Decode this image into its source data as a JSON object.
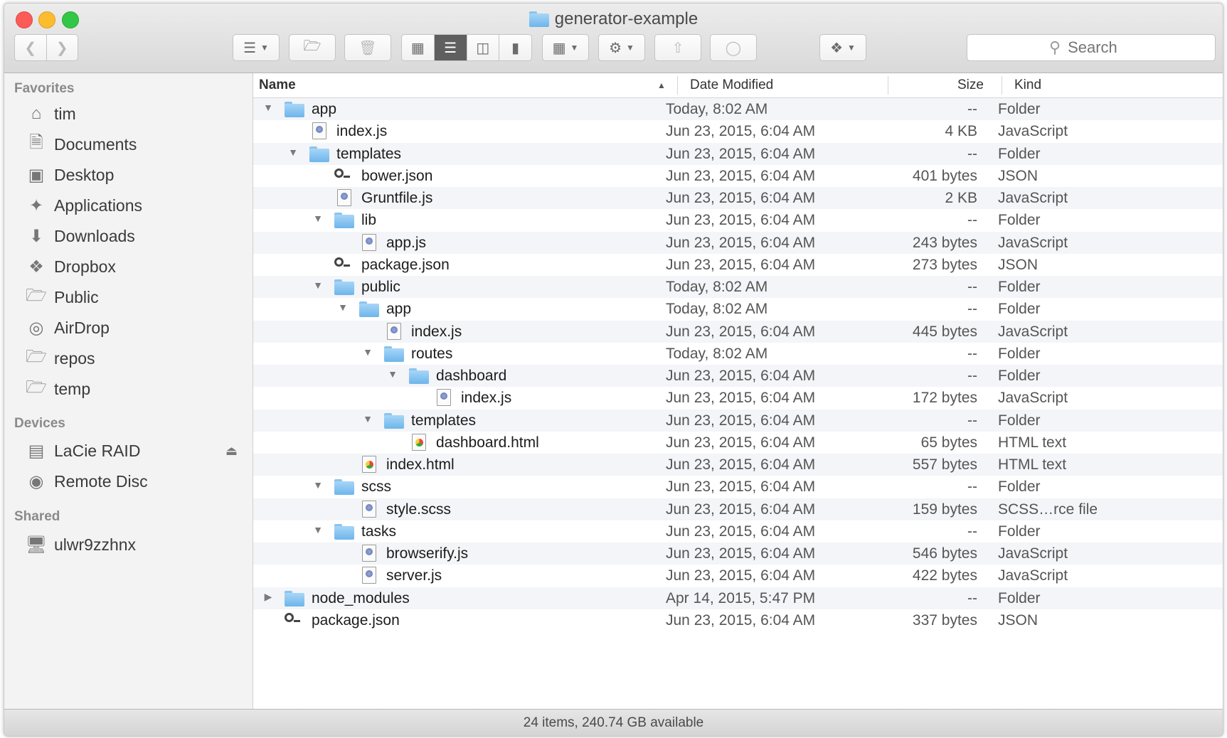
{
  "window": {
    "title": "generator-example",
    "status": "24 items, 240.74 GB available"
  },
  "toolbar": {
    "search_placeholder": "Search"
  },
  "sidebar": {
    "sections": [
      {
        "heading": "Favorites",
        "items": [
          {
            "label": "tim",
            "icon": "home-icon"
          },
          {
            "label": "Documents",
            "icon": "documents-icon"
          },
          {
            "label": "Desktop",
            "icon": "desktop-icon"
          },
          {
            "label": "Applications",
            "icon": "applications-icon"
          },
          {
            "label": "Downloads",
            "icon": "downloads-icon"
          },
          {
            "label": "Dropbox",
            "icon": "dropbox-icon"
          },
          {
            "label": "Public",
            "icon": "folder-icon"
          },
          {
            "label": "AirDrop",
            "icon": "airdrop-icon"
          },
          {
            "label": "repos",
            "icon": "folder-icon"
          },
          {
            "label": "temp",
            "icon": "folder-icon"
          }
        ]
      },
      {
        "heading": "Devices",
        "items": [
          {
            "label": "LaCie RAID",
            "icon": "drive-icon"
          },
          {
            "label": "Remote Disc",
            "icon": "disc-icon"
          }
        ]
      },
      {
        "heading": "Shared",
        "items": [
          {
            "label": "ulwr9zzhnx",
            "icon": "computer-icon"
          }
        ]
      }
    ]
  },
  "columns": {
    "name": "Name",
    "date": "Date Modified",
    "size": "Size",
    "kind": "Kind"
  },
  "files": [
    {
      "name": "app",
      "date": "Today, 8:02 AM",
      "size": "--",
      "kind": "Folder",
      "type": "folder",
      "depth": 0,
      "expanded": true
    },
    {
      "name": "index.js",
      "date": "Jun 23, 2015, 6:04 AM",
      "size": "4 KB",
      "kind": "JavaScript",
      "type": "js",
      "depth": 1
    },
    {
      "name": "templates",
      "date": "Jun 23, 2015, 6:04 AM",
      "size": "--",
      "kind": "Folder",
      "type": "folder",
      "depth": 1,
      "expanded": true
    },
    {
      "name": "bower.json",
      "date": "Jun 23, 2015, 6:04 AM",
      "size": "401 bytes",
      "kind": "JSON",
      "type": "json",
      "depth": 2
    },
    {
      "name": "Gruntfile.js",
      "date": "Jun 23, 2015, 6:04 AM",
      "size": "2 KB",
      "kind": "JavaScript",
      "type": "js",
      "depth": 2
    },
    {
      "name": "lib",
      "date": "Jun 23, 2015, 6:04 AM",
      "size": "--",
      "kind": "Folder",
      "type": "folder",
      "depth": 2,
      "expanded": true
    },
    {
      "name": "app.js",
      "date": "Jun 23, 2015, 6:04 AM",
      "size": "243 bytes",
      "kind": "JavaScript",
      "type": "js",
      "depth": 3
    },
    {
      "name": "package.json",
      "date": "Jun 23, 2015, 6:04 AM",
      "size": "273 bytes",
      "kind": "JSON",
      "type": "json",
      "depth": 2
    },
    {
      "name": "public",
      "date": "Today, 8:02 AM",
      "size": "--",
      "kind": "Folder",
      "type": "folder",
      "depth": 2,
      "expanded": true
    },
    {
      "name": "app",
      "date": "Today, 8:02 AM",
      "size": "--",
      "kind": "Folder",
      "type": "folder",
      "depth": 3,
      "expanded": true
    },
    {
      "name": "index.js",
      "date": "Jun 23, 2015, 6:04 AM",
      "size": "445 bytes",
      "kind": "JavaScript",
      "type": "js",
      "depth": 4
    },
    {
      "name": "routes",
      "date": "Today, 8:02 AM",
      "size": "--",
      "kind": "Folder",
      "type": "folder",
      "depth": 4,
      "expanded": true
    },
    {
      "name": "dashboard",
      "date": "Jun 23, 2015, 6:04 AM",
      "size": "--",
      "kind": "Folder",
      "type": "folder",
      "depth": 5,
      "expanded": true
    },
    {
      "name": "index.js",
      "date": "Jun 23, 2015, 6:04 AM",
      "size": "172 bytes",
      "kind": "JavaScript",
      "type": "js",
      "depth": 6
    },
    {
      "name": "templates",
      "date": "Jun 23, 2015, 6:04 AM",
      "size": "--",
      "kind": "Folder",
      "type": "folder",
      "depth": 4,
      "expanded": true
    },
    {
      "name": "dashboard.html",
      "date": "Jun 23, 2015, 6:04 AM",
      "size": "65 bytes",
      "kind": "HTML text",
      "type": "html",
      "depth": 5
    },
    {
      "name": "index.html",
      "date": "Jun 23, 2015, 6:04 AM",
      "size": "557 bytes",
      "kind": "HTML text",
      "type": "html",
      "depth": 3
    },
    {
      "name": "scss",
      "date": "Jun 23, 2015, 6:04 AM",
      "size": "--",
      "kind": "Folder",
      "type": "folder",
      "depth": 2,
      "expanded": true
    },
    {
      "name": "style.scss",
      "date": "Jun 23, 2015, 6:04 AM",
      "size": "159 bytes",
      "kind": "SCSS…rce file",
      "type": "js",
      "depth": 3
    },
    {
      "name": "tasks",
      "date": "Jun 23, 2015, 6:04 AM",
      "size": "--",
      "kind": "Folder",
      "type": "folder",
      "depth": 2,
      "expanded": true
    },
    {
      "name": "browserify.js",
      "date": "Jun 23, 2015, 6:04 AM",
      "size": "546 bytes",
      "kind": "JavaScript",
      "type": "js",
      "depth": 3
    },
    {
      "name": "server.js",
      "date": "Jun 23, 2015, 6:04 AM",
      "size": "422 bytes",
      "kind": "JavaScript",
      "type": "js",
      "depth": 3
    },
    {
      "name": "node_modules",
      "date": "Apr 14, 2015, 5:47 PM",
      "size": "--",
      "kind": "Folder",
      "type": "folder",
      "depth": 0,
      "expanded": false
    },
    {
      "name": "package.json",
      "date": "Jun 23, 2015, 6:04 AM",
      "size": "337 bytes",
      "kind": "JSON",
      "type": "json",
      "depth": 0
    }
  ],
  "colors": {
    "accent": "#6db5eb",
    "row_alt": "#f3f5f8",
    "sidebar_bg": "#f3f3f3"
  }
}
